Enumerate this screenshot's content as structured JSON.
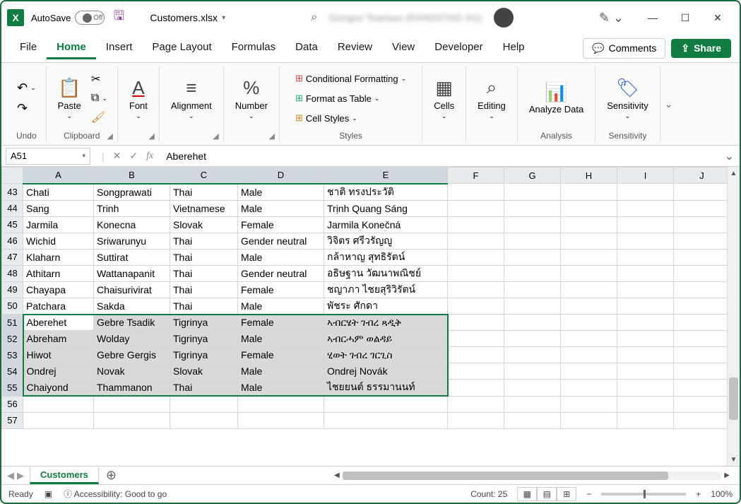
{
  "titlebar": {
    "autosave_label": "AutoSave",
    "autosave_state": "Off",
    "filename": "Customers.xlsx",
    "account_blur": "Giorgos Tsartsas (RANDSTAD AG)"
  },
  "menutabs": {
    "items": [
      "File",
      "Home",
      "Insert",
      "Page Layout",
      "Formulas",
      "Data",
      "Review",
      "View",
      "Developer",
      "Help"
    ],
    "active": 1,
    "comments": "Comments",
    "share": "Share"
  },
  "ribbon": {
    "undo": {
      "label": "Undo"
    },
    "clipboard": {
      "label": "Clipboard",
      "paste": "Paste"
    },
    "font": {
      "label": "Font"
    },
    "alignment": {
      "label": "Alignment"
    },
    "number": {
      "label": "Number"
    },
    "styles": {
      "label": "Styles",
      "conditional": "Conditional Formatting",
      "table": "Format as Table",
      "cellstyles": "Cell Styles"
    },
    "cells": {
      "label": "Cells"
    },
    "editing": {
      "label": "Editing"
    },
    "analysis": {
      "label": "Analysis",
      "analyze": "Analyze Data"
    },
    "sensitivity": {
      "label": "Sensitivity",
      "btn": "Sensitivity"
    }
  },
  "formulabar": {
    "namebox": "A51",
    "formula": "Aberehet"
  },
  "grid": {
    "columns": [
      "A",
      "B",
      "C",
      "D",
      "E",
      "F",
      "G",
      "H",
      "I",
      "J"
    ],
    "rows": [
      {
        "n": 43,
        "cells": [
          "Chati",
          "Songprawati",
          "Thai",
          "Male",
          "ชาติ ทรงประวัติ",
          "",
          "",
          "",
          "",
          ""
        ]
      },
      {
        "n": 44,
        "cells": [
          "Sang",
          "Trinh",
          "Vietnamese",
          "Male",
          "Trịnh Quang Sáng",
          "",
          "",
          "",
          "",
          ""
        ]
      },
      {
        "n": 45,
        "cells": [
          "Jarmila",
          "Konecna",
          "Slovak",
          "Female",
          "Jarmila Konečná",
          "",
          "",
          "",
          "",
          ""
        ]
      },
      {
        "n": 46,
        "cells": [
          "Wichid",
          "Sriwarunyu",
          "Thai",
          "Gender neutral",
          "วิจิตร ศรีวรัญญู",
          "",
          "",
          "",
          "",
          ""
        ]
      },
      {
        "n": 47,
        "cells": [
          "Klaharn",
          "Suttirat",
          "Thai",
          "Male",
          "กล้าหาญ สุทธิรัตน์",
          "",
          "",
          "",
          "",
          ""
        ]
      },
      {
        "n": 48,
        "cells": [
          "Athitarn",
          "Wattanapanit",
          "Thai",
          "Gender neutral",
          "อธิษฐาน วัฒนาพณิชย์",
          "",
          "",
          "",
          "",
          ""
        ]
      },
      {
        "n": 49,
        "cells": [
          "Chayapa",
          "Chaisurivirat",
          "Thai",
          "Female",
          "ชญาภา ไชยสุริวิรัตน์",
          "",
          "",
          "",
          "",
          ""
        ]
      },
      {
        "n": 50,
        "cells": [
          "Patchara",
          "Sakda",
          "Thai",
          "Male",
          "พัชระ ศักดา",
          "",
          "",
          "",
          "",
          ""
        ]
      },
      {
        "n": 51,
        "cells": [
          "Aberehet",
          "Gebre Tsadik",
          "Tigrinya",
          "Female",
          "ኣብርሄት ገብረ ጻዲቅ",
          "",
          "",
          "",
          "",
          ""
        ]
      },
      {
        "n": 52,
        "cells": [
          "Abreham",
          "Wolday",
          "Tigrinya",
          "Male",
          "ኣብርሓም ወልዳይ",
          "",
          "",
          "",
          "",
          ""
        ]
      },
      {
        "n": 53,
        "cells": [
          "Hiwot",
          "Gebre Gergis",
          "Tigrinya",
          "Female",
          "ሂወት ገብረ ገርጊስ",
          "",
          "",
          "",
          "",
          ""
        ]
      },
      {
        "n": 54,
        "cells": [
          "Ondrej",
          "Novak",
          "Slovak",
          "Male",
          "Ondrej Novák",
          "",
          "",
          "",
          "",
          ""
        ]
      },
      {
        "n": 55,
        "cells": [
          "Chaiyond",
          "Thammanon",
          "Thai",
          "Male",
          "ไชยยนต์ ธรรมานนท์",
          "",
          "",
          "",
          "",
          ""
        ]
      },
      {
        "n": 56,
        "cells": [
          "",
          "",
          "",
          "",
          "",
          "",
          "",
          "",
          "",
          ""
        ]
      },
      {
        "n": 57,
        "cells": [
          "",
          "",
          "",
          "",
          "",
          "",
          "",
          "",
          "",
          ""
        ]
      }
    ],
    "selection": {
      "startRow": 51,
      "endRow": 55,
      "startCol": 0,
      "endCol": 4,
      "activeCell": "A51"
    }
  },
  "sheettabs": {
    "active": "Customers"
  },
  "statusbar": {
    "ready": "Ready",
    "accessibility": "Accessibility: Good to go",
    "count": "Count: 25",
    "zoom": "100%"
  }
}
